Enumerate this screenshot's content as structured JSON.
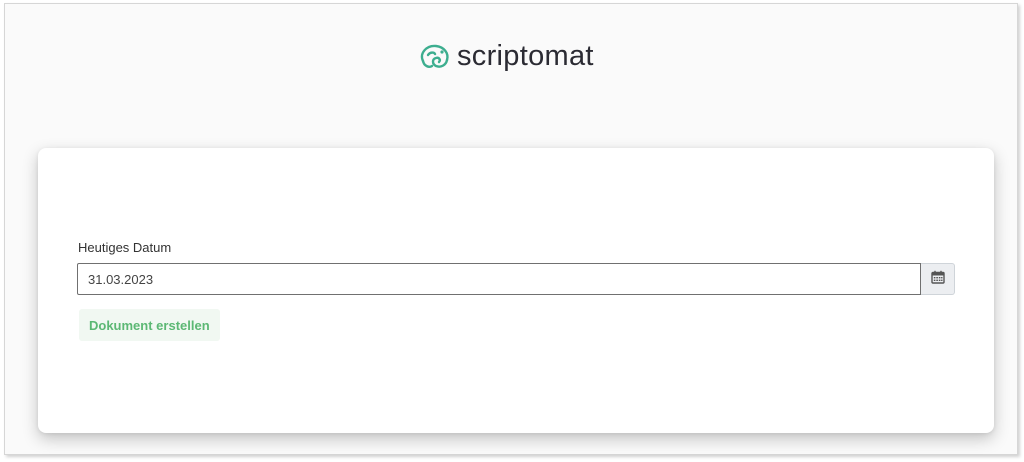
{
  "brand": {
    "name": "scriptomat",
    "icon": "chameleon-logo-icon",
    "color": "#3dae8f"
  },
  "form": {
    "date_label": "Heutiges Datum",
    "date_value": "31.03.2023",
    "calendar_icon": "calendar-icon",
    "submit_label": "Dokument erstellen"
  },
  "colors": {
    "accent": "#5cb874",
    "button_bg": "#f1f8f2",
    "brand_teal": "#3dae8f"
  }
}
